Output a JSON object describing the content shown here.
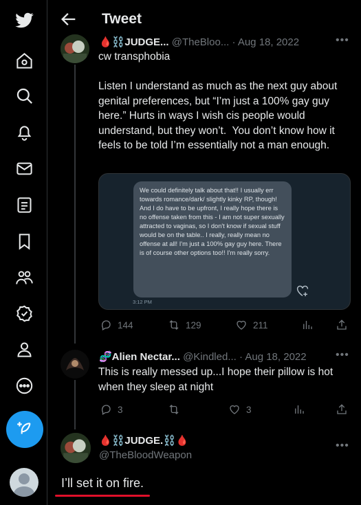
{
  "nav": {
    "items": [
      "twitter-logo",
      "home",
      "explore",
      "notifications",
      "messages",
      "lists",
      "bookmarks",
      "communities",
      "verified",
      "profile",
      "more"
    ]
  },
  "header": {
    "title": "Tweet"
  },
  "tweet1": {
    "display_name": "🩸⛓️JUDGE...",
    "handle": "@TheBloo...",
    "date": "· Aug 18, 2022",
    "text": "cw transphobia\n\nListen I understand as much as the next guy about genital preferences, but “I’m just a 100% gay guy here.” Hurts in ways I wish cis people would understand, but they won’t.  You don’t know how it feels to be told I’m essentially not a man enough.",
    "image_message": "We could definitely talk about that!! I usually err towards romance/dark/ slightly kinky RP, though! And I do have to be upfront, I really hope there is no offense taken from this - I am not super sexually attracted to vaginas, so I don't know if sexual stuff would be on the table.. I really, really mean no offense at all! I'm just a 100% gay guy here. There is of course other options too!! I'm really sorry.",
    "image_time": "3:12 PM",
    "replies": "144",
    "retweets": "129",
    "likes": "211"
  },
  "tweet2": {
    "display_name": "🧬Alien Nectar...",
    "handle": "@Kindled...",
    "date": "· Aug 18, 2022",
    "text": "This is really messed up...I hope their pillow is hot when they sleep at night",
    "replies": "3",
    "retweets": "",
    "likes": "3"
  },
  "tweet3": {
    "display_name": "🩸⛓️JUDGE.⛓️🩸",
    "handle": "@TheBloodWeapon",
    "text": "I’ll set it on fire."
  },
  "colors": {
    "accent": "#1d9bf0",
    "underline": "#e0102a",
    "background": "#000000"
  }
}
